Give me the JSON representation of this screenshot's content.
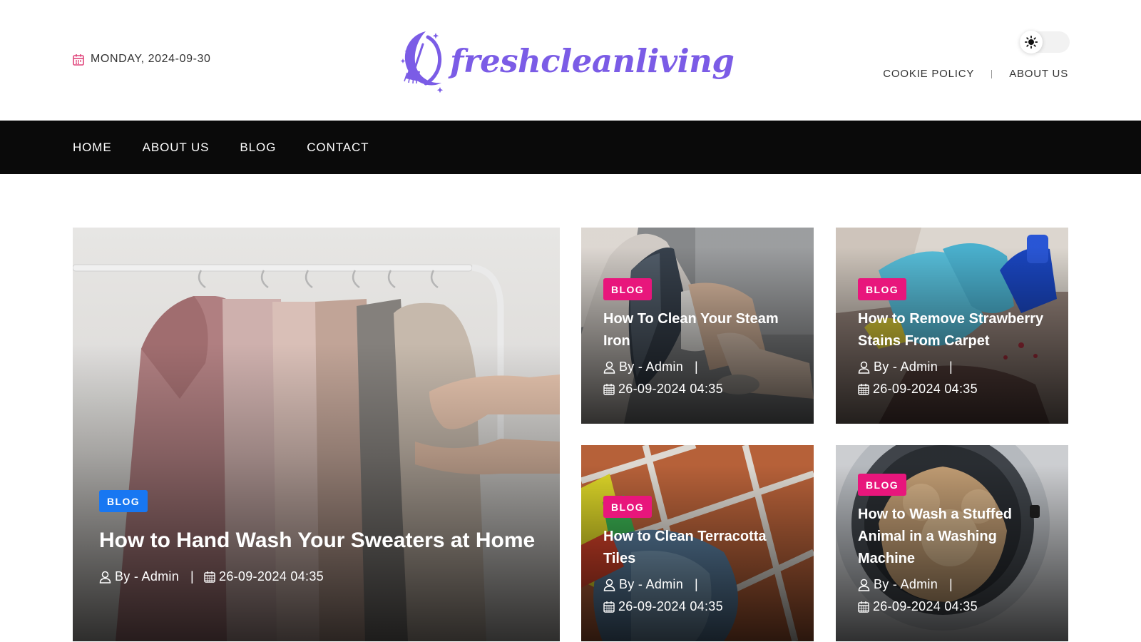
{
  "header": {
    "date": "MONDAY, 2024-09-30",
    "logo_text": "freshcleanliving",
    "top_links": [
      "COOKIE POLICY",
      "ABOUT US"
    ]
  },
  "nav": {
    "items": [
      "HOME",
      "ABOUT US",
      "BLOG",
      "CONTACT"
    ]
  },
  "featured": {
    "badge": "BLOG",
    "title": "How to Hand Wash Your Sweaters at Home",
    "author": "By - Admin",
    "date": "26-09-2024 04:35"
  },
  "posts": [
    {
      "badge": "BLOG",
      "title": "How To Clean Your Steam Iron",
      "author": "By - Admin",
      "date": "26-09-2024 04:35"
    },
    {
      "badge": "BLOG",
      "title": "How to Remove Strawberry Stains From Carpet",
      "author": "By - Admin",
      "date": "26-09-2024 04:35"
    },
    {
      "badge": "BLOG",
      "title": "How to Clean Terracotta Tiles",
      "author": "By - Admin",
      "date": "26-09-2024 04:35"
    },
    {
      "badge": "BLOG",
      "title": "How to Wash a Stuffed Animal in a Washing Machine",
      "author": "By - Admin",
      "date": "26-09-2024 04:35"
    }
  ],
  "colors": {
    "brand": "#7b5ce6",
    "badge_pink": "#e8167c",
    "badge_blue": "#1877f2",
    "nav_bg": "#0a0a0a"
  },
  "icons": {
    "date": "calendar-icon",
    "theme": "sun-icon",
    "author": "user-icon",
    "post_date": "calendar-icon"
  }
}
